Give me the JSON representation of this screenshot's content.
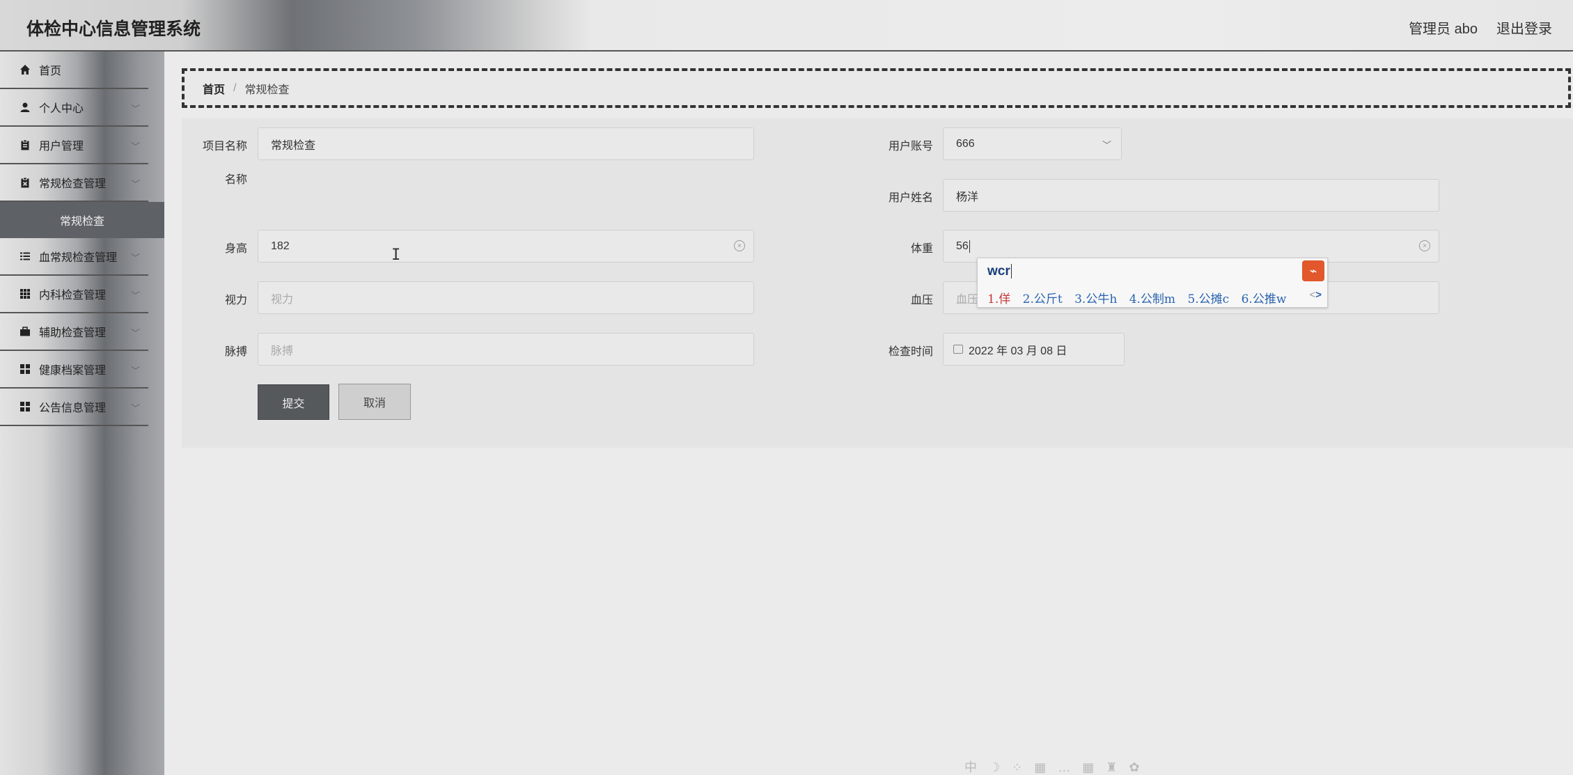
{
  "header": {
    "title": "体检中心信息管理系统",
    "admin": "管理员 abo",
    "logout": "退出登录"
  },
  "sidebar": {
    "items": [
      {
        "label": "首页",
        "icon": "home-icon"
      },
      {
        "label": "个人中心",
        "icon": "user-icon"
      },
      {
        "label": "用户管理",
        "icon": "clipboard-icon"
      },
      {
        "label": "常规检查管理",
        "icon": "clipboard-x-icon"
      },
      {
        "label": "常规检查",
        "icon": ""
      },
      {
        "label": "血常规检查管理",
        "icon": "list-icon"
      },
      {
        "label": "内科检查管理",
        "icon": "grid-icon"
      },
      {
        "label": "辅助检查管理",
        "icon": "briefcase-icon"
      },
      {
        "label": "健康档案管理",
        "icon": "apps-icon"
      },
      {
        "label": "公告信息管理",
        "icon": "apps-icon"
      }
    ]
  },
  "breadcrumb": {
    "home": "首页",
    "sep": "/",
    "current": "常规检查"
  },
  "form": {
    "project_name_label": "项目名称",
    "project_name_value": "常规检查",
    "name_label": "名称",
    "user_account_label": "用户账号",
    "user_account_value": "666",
    "user_name_label": "用户姓名",
    "user_name_value": "杨洋",
    "height_label": "身高",
    "height_value": "182",
    "weight_label": "体重",
    "weight_value": "56",
    "vision_label": "视力",
    "vision_placeholder": "视力",
    "blood_pressure_label": "血压",
    "blood_pressure_placeholder": "血压",
    "pulse_label": "脉搏",
    "pulse_placeholder": "脉搏",
    "check_time_label": "检查时间",
    "check_time_value": "2022 年 03 月 08 日",
    "submit": "提交",
    "cancel": "取消"
  },
  "ime": {
    "code": "wcr",
    "candidates": [
      "1.佯",
      "2.公斤t",
      "3.公牛h",
      "4.公制m",
      "5.公摊c",
      "6.公推w"
    ],
    "nav": "<",
    "nav_next": ">"
  },
  "tray": "中 ☽ ⁘ ▦ … ▦ ♜ ✿"
}
